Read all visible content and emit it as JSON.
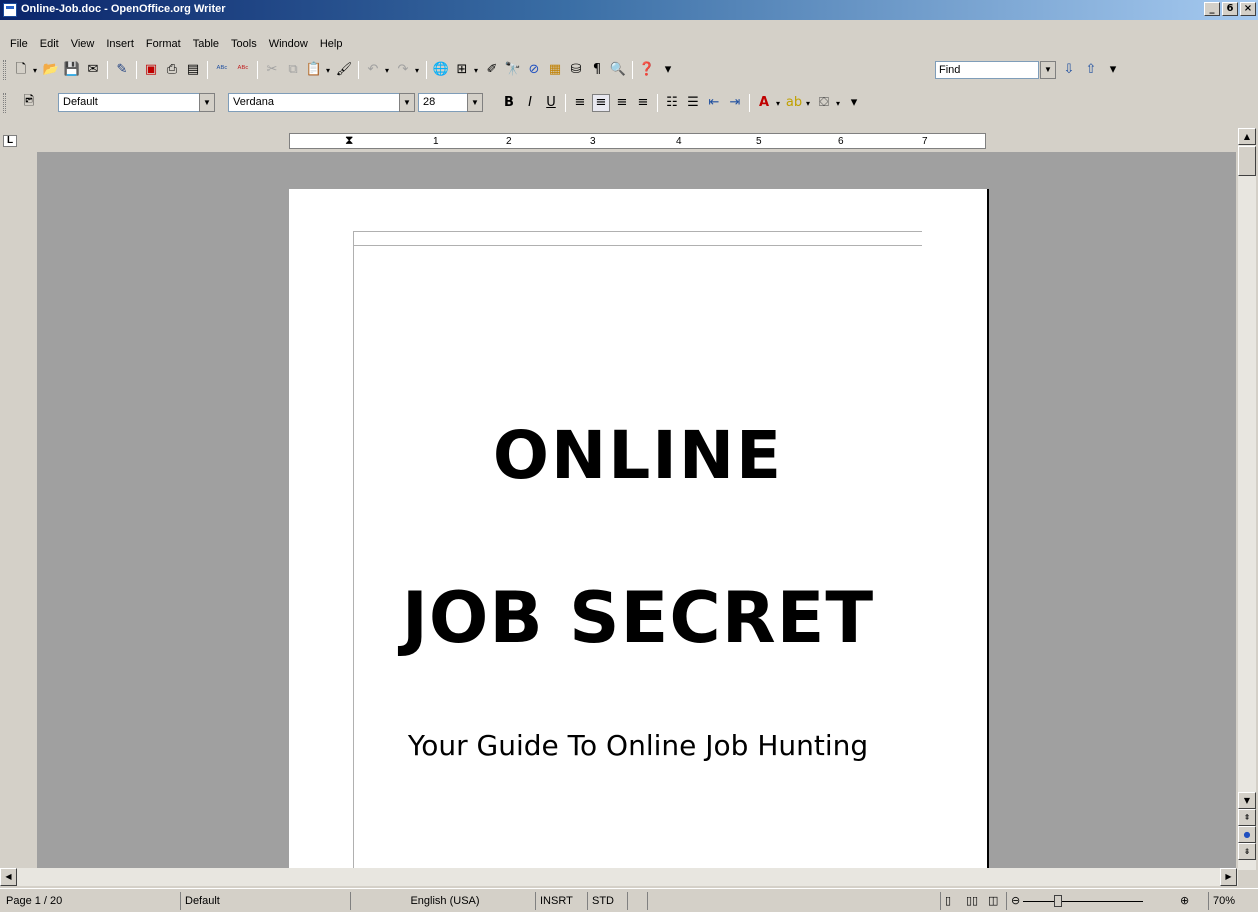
{
  "window": {
    "title": "Online-Job.doc - OpenOffice.org Writer",
    "buttons": [
      "_",
      "6",
      "×"
    ]
  },
  "menu": [
    "File",
    "Edit",
    "View",
    "Insert",
    "Format",
    "Table",
    "Tools",
    "Window",
    "Help"
  ],
  "toolbar": {
    "find_placeholder": "Find"
  },
  "formatting": {
    "style": "Default",
    "font": "Verdana",
    "size": "28"
  },
  "document": {
    "title_line1": "ONLINE",
    "title_line2": "JOB SECRET",
    "subtitle": "Your Guide To Online Job Hunting"
  },
  "ruler": {
    "ticks": [
      "1",
      "2",
      "3",
      "4",
      "5",
      "6",
      "7"
    ]
  },
  "status": {
    "page": "Page 1 / 20",
    "style": "Default",
    "language": "English (USA)",
    "insert_mode": "INSRT",
    "selection_mode": "STD",
    "zoom": "70%"
  }
}
